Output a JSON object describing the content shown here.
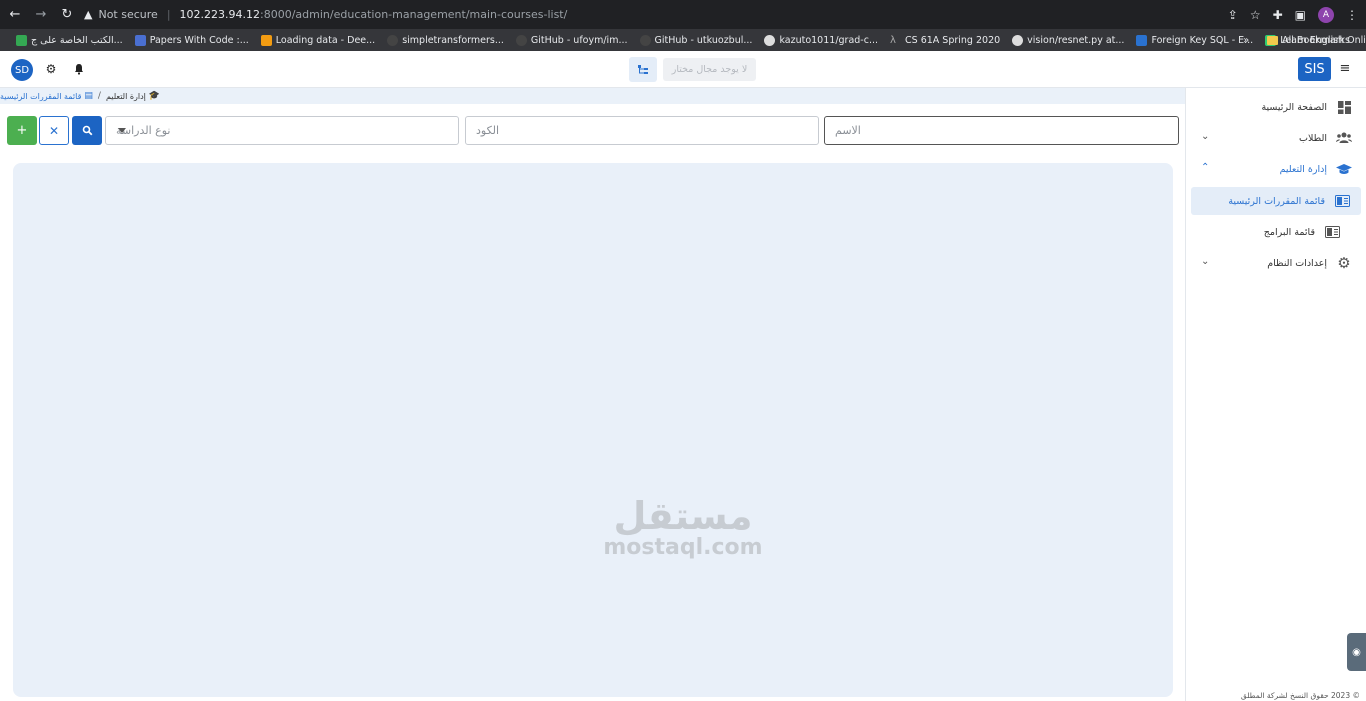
{
  "browser": {
    "security_label": "Not secure",
    "url_host": "102.223.94.12",
    "url_path": ":8000/admin/education-management/main-courses-list/",
    "profile_initial": "A",
    "bookmarks": [
      {
        "label": "الكتب الخاصة على ج...",
        "color": "#34a853"
      },
      {
        "label": "Papers With Code :...",
        "color": "#4a6fd1"
      },
      {
        "label": "Loading data - Dee...",
        "color": "#f39c12"
      },
      {
        "label": "simpletransformers...",
        "color": "#444"
      },
      {
        "label": "GitHub - ufoym/im...",
        "color": "#444"
      },
      {
        "label": "GitHub - utkuozbul...",
        "color": "#444"
      },
      {
        "label": "kazuto1011/grad-c...",
        "color": "#ddd"
      },
      {
        "label": "CS 61A Spring 2020",
        "color": "#777"
      },
      {
        "label": "vision/resnet.py at...",
        "color": "#ddd"
      },
      {
        "label": "Foreign Key SQL - E...",
        "color": "#2a72d0"
      },
      {
        "label": "Learn English Onlin...",
        "color": "#2ecc71"
      }
    ],
    "all_bookmarks_label": "All Bookmarks"
  },
  "topbar": {
    "avatar_initials": "SD",
    "field_select_placeholder": "لا يوجد مجال مختار",
    "brand": "SIS"
  },
  "breadcrumb": {
    "parent": "إدارة التعليم",
    "current": "قائمة المقررات الرئيسية"
  },
  "filters": {
    "name_placeholder": "الاسم",
    "code_placeholder": "الكود",
    "study_type_placeholder": "نوع الدراسة"
  },
  "sidebar": {
    "items": [
      {
        "label": "الصفحة الرئيسية"
      },
      {
        "label": "الطلاب"
      },
      {
        "label": "إدارة التعليم"
      },
      {
        "label": "قائمة المقررات الرئيسية"
      },
      {
        "label": "قائمة البرامج"
      },
      {
        "label": "إعدادات النظام"
      }
    ]
  },
  "footer": {
    "text": "© 2023 حقوق النسخ لشركة المطلق"
  },
  "watermark": {
    "arabic": "مستقل",
    "latin": "mostaql.com"
  }
}
